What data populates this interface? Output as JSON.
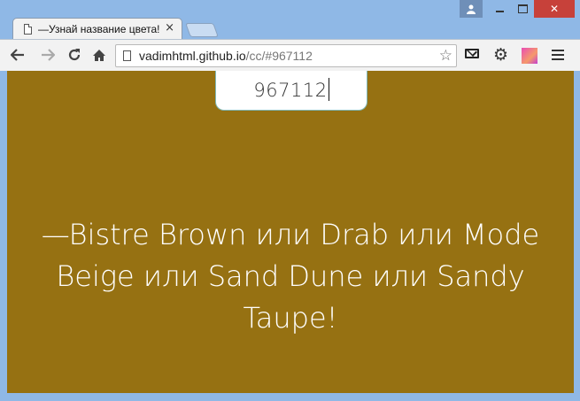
{
  "browser": {
    "tab_title": "—Узнай название цвета!",
    "tab_close": "×",
    "url_host": "vadimhtml.github.io",
    "url_path": "/cc/#967112",
    "bookmark_star": "☆",
    "settings_glyph": "⚙",
    "back_glyph": "←",
    "forward_glyph": "→",
    "reload_glyph": "↻",
    "home_glyph": "⌂",
    "user_glyph": "👤",
    "close_glyph": "✕"
  },
  "page": {
    "hex_input_value": "967112",
    "background_color": "#967112",
    "color_name_text": "—Bistre Brown или Drab или Mode Beige или Sand Dune или Sandy Taupe!"
  },
  "colors": {
    "accent_close": "#c7413a",
    "page_background": "#967112"
  }
}
